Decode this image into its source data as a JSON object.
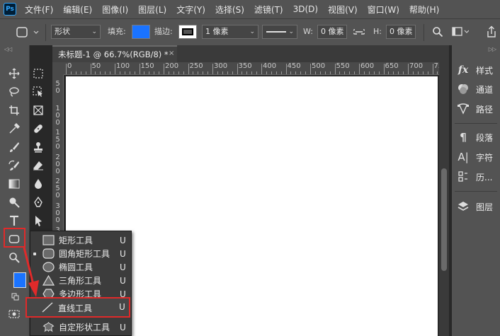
{
  "app": {
    "logo_text": "Ps"
  },
  "menu": [
    "文件(F)",
    "编辑(E)",
    "图像(I)",
    "图层(L)",
    "文字(Y)",
    "选择(S)",
    "滤镜(T)",
    "3D(D)",
    "视图(V)",
    "窗口(W)",
    "帮助(H)"
  ],
  "options_bar": {
    "mode_value": "形状",
    "fill_label": "填充:",
    "fill_color": "#1a73ff",
    "stroke_label": "描边:",
    "stroke_width_value": "1 像素",
    "w_label": "W:",
    "w_value": "0 像素",
    "h_label": "H:",
    "h_value": "0 像素"
  },
  "document": {
    "tab_title": "未标题-1 @ 66.7%(RGB/8) *",
    "tab_close": "×",
    "ruler_top": [
      "0",
      "50",
      "100",
      "150",
      "200",
      "250",
      "300",
      "350",
      "400",
      "450",
      "500",
      "550",
      "600",
      "650",
      "700",
      "750"
    ],
    "ruler_left": [
      "5\n0",
      "1\n0\n0",
      "1\n5\n0",
      "2\n0\n0",
      "2\n5\n0",
      "3\n0\n0",
      "3\n5\n0",
      "4\n0\n0",
      "4\n5\n0"
    ]
  },
  "colors": {
    "foreground": "#1a73ff",
    "background": "#ffffff",
    "highlight": "#e02a2a"
  },
  "right_panel": {
    "items": [
      {
        "icon": "fx-icon",
        "label": "样式"
      },
      {
        "icon": "channels-icon",
        "label": "通道"
      },
      {
        "icon": "paths-icon",
        "label": "路径"
      },
      {
        "icon": "paragraph-icon",
        "label": "段落"
      },
      {
        "icon": "character-icon",
        "label": "字符"
      },
      {
        "icon": "history-icon",
        "label": "历..."
      },
      {
        "icon": "layers-icon",
        "label": "图层"
      }
    ]
  },
  "flyout": {
    "items": [
      {
        "label": "矩形工具",
        "key": "U",
        "icon": "rectangle-icon",
        "active": false
      },
      {
        "label": "圆角矩形工具",
        "key": "U",
        "icon": "rounded-rectangle-icon",
        "active": true
      },
      {
        "label": "椭圆工具",
        "key": "U",
        "icon": "ellipse-icon",
        "active": false
      },
      {
        "label": "三角形工具",
        "key": "U",
        "icon": "triangle-icon",
        "active": false
      },
      {
        "label": "多边形工具",
        "key": "U",
        "icon": "polygon-icon",
        "active": false
      },
      {
        "label": "直线工具",
        "key": "U",
        "icon": "line-icon",
        "active": false
      },
      {
        "label": "自定形状工具",
        "key": "U",
        "icon": "custom-shape-icon",
        "active": false
      }
    ]
  }
}
